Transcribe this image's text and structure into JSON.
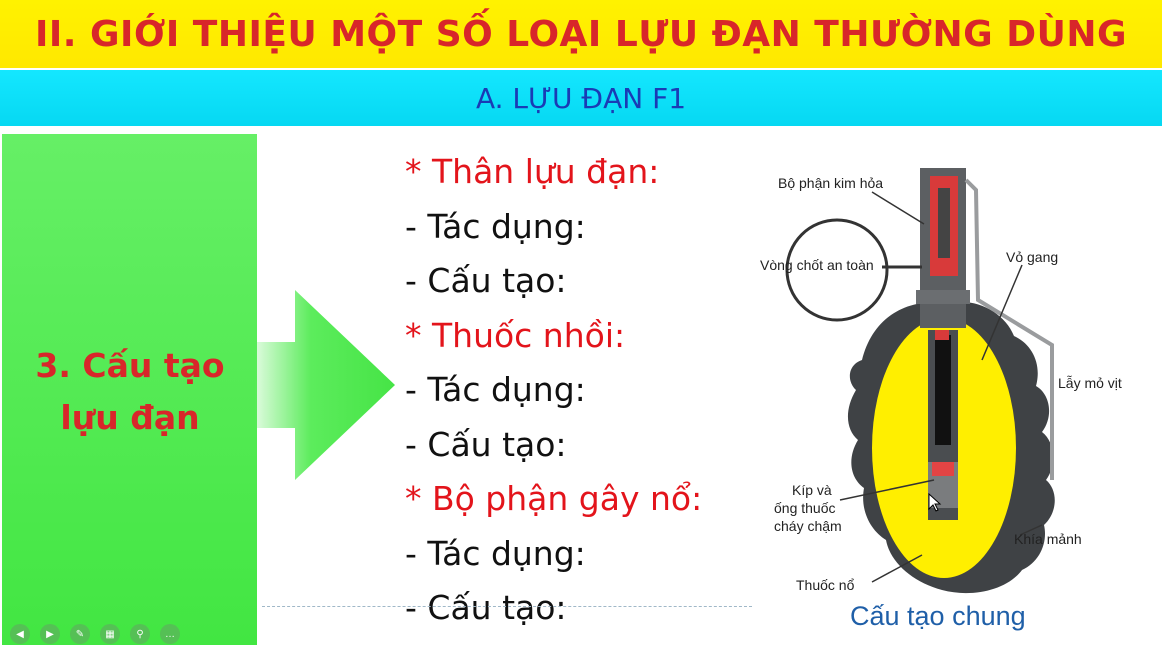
{
  "slide": {
    "title": "II. GIỚI THIỆU MỘT SỐ LOẠI LỰU ĐẠN THƯỜNG DÙNG",
    "subtitle": "A. LỰU ĐẠN F1",
    "section_label_line1": "3. Cấu tạo",
    "section_label_line2": "lựu đạn",
    "items": [
      {
        "text": "* Thân lựu đạn:",
        "kind": "head"
      },
      {
        "text": "- Tác dụng:",
        "kind": "sub"
      },
      {
        "text": "- Cấu tạo:",
        "kind": "sub"
      },
      {
        "text": "* Thuốc nhồi:",
        "kind": "head"
      },
      {
        "text": "- Tác dụng:",
        "kind": "sub"
      },
      {
        "text": "- Cấu tạo:",
        "kind": "sub"
      },
      {
        "text": "* Bộ phận gây nổ:",
        "kind": "head"
      },
      {
        "text": "- Tác dụng:",
        "kind": "sub"
      },
      {
        "text": "- Cấu tạo:",
        "kind": "sub"
      }
    ]
  },
  "diagram": {
    "labels": {
      "firing_mechanism": "Bộ phận kim hỏa",
      "safety_ring": "Vòng chốt an toàn",
      "iron_shell": "Vỏ gang",
      "lever": "Lẫy mỏ vịt",
      "detonator_line1": "Kíp và",
      "detonator_line2": "ống thuốc",
      "detonator_line3": "cháy chậm",
      "fragment_grooves": "Khía mảnh",
      "explosive": "Thuốc nổ"
    },
    "caption": "Cấu tạo chung"
  },
  "player_controls": [
    "prev-icon",
    "next-icon",
    "pen-icon",
    "grid-icon",
    "zoom-icon",
    "more-icon"
  ],
  "colors": {
    "title_bg": "#fff200",
    "title_text": "#d8262a",
    "subtitle_bg": "#14e7ff",
    "subtitle_text": "#1a3bb5",
    "green": "#52ea52",
    "explosive": "#ffef00"
  }
}
